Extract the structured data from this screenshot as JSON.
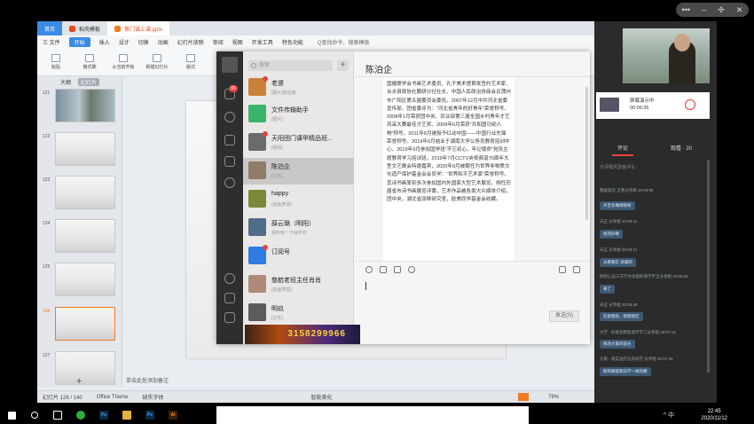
{
  "ppt": {
    "tabs": [
      {
        "label": "首页",
        "kind": "home"
      },
      {
        "label": "稻壳模板",
        "kind": "normal"
      },
      {
        "label": "第门课上课.pptx",
        "kind": "active"
      }
    ],
    "menu": [
      "三 文件",
      "开始",
      "插入",
      "设计",
      "切换",
      "动画",
      "幻灯片放映",
      "审阅",
      "视图",
      "开发工具",
      "特色功能"
    ],
    "menu_search": "Q查找命令、搜索模板",
    "toolbar": [
      "粘贴",
      "格式刷",
      "从当前开始",
      "新建幻灯片",
      "版式",
      "节"
    ],
    "view_tabs": [
      "大纲",
      "幻灯片"
    ],
    "thumbs": [
      "121",
      "122",
      "123",
      "124",
      "125",
      "126",
      "127"
    ],
    "add_label": "+",
    "notes_placeholder": "单击此处添加备注",
    "status": {
      "slide": "幻灯片 126 / 140",
      "theme": "Office Theme",
      "repair": "缺失字体",
      "smart": "智能美化",
      "zoom": "79%"
    }
  },
  "chat": {
    "search_placeholder": "搜索",
    "plus": "+",
    "rail_badge": "99",
    "title": "陈泊企",
    "conversations": [
      {
        "name": "老婆",
        "msg": "[图片]我后面",
        "time": "",
        "avatar_color": "#c9823a",
        "dot": true
      },
      {
        "name": "文件传输助手",
        "msg": "[图片]",
        "time": "",
        "avatar_color": "#3bb36a",
        "dot": false
      },
      {
        "name": "天阳团门课甲精品班...",
        "msg": "[视频]",
        "time": "",
        "avatar_color": "#6b6b6b",
        "dot": true
      },
      {
        "name": "陈泊企",
        "msg": "[文件]",
        "time": "",
        "avatar_color": "#8f7c68",
        "dot": false
      },
      {
        "name": "happy",
        "msg": "[动画表情]",
        "time": "",
        "avatar_color": "#7a8a3a",
        "dot": false
      },
      {
        "name": "薛云璐（明阳）",
        "msg": "我听她一下就不吵",
        "time": "",
        "avatar_color": "#4f6c8a",
        "dot": false
      },
      {
        "name": "订阅号",
        "msg": "",
        "time": "",
        "avatar_color": "#2f7de1",
        "dot": true
      },
      {
        "name": "慈航老班主任肖肖",
        "msg": "[动画表情]",
        "time": "",
        "avatar_color": "#b08a78",
        "dot": false
      },
      {
        "name": "明玖",
        "msg": "[文件]",
        "time": "",
        "avatar_color": "#5c5c5c",
        "dot": false
      }
    ],
    "message": "国楹联学会书画艺术委员、孔子美术馆首批签约艺术家、合水县政协社鹏研分社社长、中国人民政治协商会议蒲州市广阳区第五届委员会委员。2007年12月中共河北省委宣传部、团省委评为：“河北省青年的好青年”荣誉称号。2008年1月荣获团中央、农业部第三届全国乡村青年才艺风采大赛最佳才艺奖。2009年6月荣获“共和国功勋人物”称号，2011年6月被授予红动中国——中国行业先锋荣誉称号。2019年6月结业于湖南大学公务员教育培训中心，2019年9月参加国学班“不忘初心，牢记使命”党员主题教育学习培训班，2019年7月CCTV央视频道70周年大型文艺晚会特邀嘉宾，2020年9月被聘任为世界非物质文化遗产保护基金会会员学：“世界和平艺术家”荣誉称号。其诗书画篆刻多次参加国内外国家大型艺术展览，相任历届省市诗书画展览评委，艺术作品被各类大众媒体介绍，团中央，湖北省双柳研究室，欧美同学基金会收藏。",
    "send_label": "发送(S)"
  },
  "banner": "3158299966",
  "right": {
    "share_title": "屏幕演示中",
    "share_time": "00:06:36",
    "tab_comments": "评论",
    "tab_viewers": "观看 · 20",
    "comment_hint": "光评模风游客评论 ·",
    "comments": [
      {
        "meta": "我就观次 王勇分享组 20:09:05",
        "text": "声音有嘴啊啦呀"
      },
      {
        "meta": "天正 分享组 20:09:11",
        "text": "很完好啊"
      },
      {
        "meta": "天正 分享组 20:06:21",
        "text": "光看看吃 调满吧"
      },
      {
        "meta": "你的心态三方行为也观的请学不全分享组 20:06:35",
        "text": "来了"
      },
      {
        "meta": "天正 分享组 20:06:40",
        "text": "在跟我啦，嗯嗯嗯吃"
      },
      {
        "meta": "大学 - 的适合和变调学学二分享组 20:07:14",
        "text": "修改大家的观光"
      },
      {
        "meta": "大家 - 现实运行让的同学 分享组 20:07:40",
        "text": "粉和嗯嗯和同学一样的哪"
      }
    ]
  },
  "taskbar": {
    "time": "22:45",
    "date": "2020/11/12",
    "tray": "^ 中",
    "apps": [
      {
        "name": "windows",
        "color": "#ffffff",
        "label": ""
      },
      {
        "name": "search",
        "color": "#ffffff",
        "label": ""
      },
      {
        "name": "task-view",
        "color": "#ffffff",
        "label": ""
      },
      {
        "name": "360",
        "color": "#2fae3d",
        "label": ""
      },
      {
        "name": "ps",
        "color": "#0b2a4a",
        "label": "Ps"
      },
      {
        "name": "explorer",
        "color": "#e3b33a",
        "label": ""
      },
      {
        "name": "ps2",
        "color": "#0b2a4a",
        "label": "Ps"
      },
      {
        "name": "ai",
        "color": "#3a1d06",
        "label": "Ai"
      }
    ]
  }
}
